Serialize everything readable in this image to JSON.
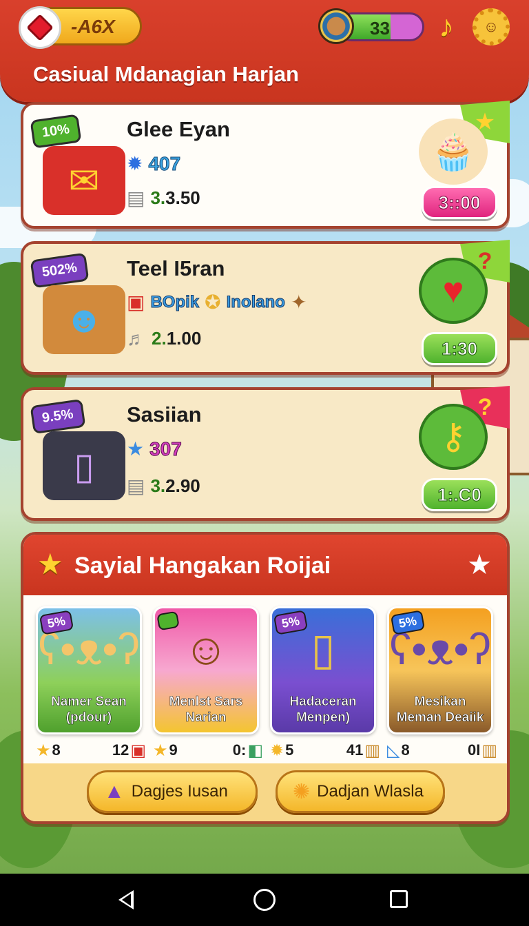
{
  "header": {
    "gem_value": "-A6X",
    "level_value": "33",
    "level_progress": 0.62,
    "title": "Casiual Mdanagian Harjan",
    "icons": [
      "gem-icon",
      "level-badge-icon",
      "music-note-icon",
      "sun-settings-icon"
    ]
  },
  "quests": [
    {
      "badge": "10%",
      "title": "Glee Eyan",
      "stat": "407",
      "cost_main": "3.",
      "cost_rest": "3.50",
      "timer": "3::00",
      "icons": [
        "red-chest-icon",
        "blue-gem-icon",
        "paper-stack-icon",
        "cupcake-icon",
        "star-flag-icon"
      ]
    },
    {
      "badge": "502%",
      "title": "Teel I5ran",
      "tag1": "BOpik",
      "tag2": "Inolano",
      "cost_main": "2.",
      "cost_rest": "1.00",
      "timer": "1:30",
      "icons": [
        "treasure-box-icon",
        "gift-icon",
        "star-coin-icon",
        "gingerbread-icon",
        "music-note-icon",
        "heart-icon",
        "question-flag-icon"
      ]
    },
    {
      "badge": "9.5%",
      "title": "Sasiian",
      "stat": "307",
      "cost_main": "3.",
      "cost_rest": "2.90",
      "timer": "1:.C0",
      "icons": [
        "smartphone-icon",
        "blue-star-icon",
        "paper-stack-icon",
        "key-icon",
        "exclamation-flag-icon"
      ]
    }
  ],
  "panel": {
    "title": "Sayial Hangakan Roijai",
    "items": [
      {
        "badge": "5%",
        "name_line1": "Namer Sean",
        "name_line2": "(pdour)",
        "left_stat": "8",
        "right_stat": "12",
        "left_icon": "star-icon",
        "right_icon": "gift-icon",
        "art_icon": "bear-icon"
      },
      {
        "badge": "",
        "name_line1": "Menlst Sars",
        "name_line2": "Narian",
        "left_stat": "9",
        "right_stat": "0:",
        "left_icon": "star-icon",
        "right_icon": "cube-icon",
        "art_icon": "boy-icon"
      },
      {
        "badge": "5%",
        "name_line1": "Hadaceran",
        "name_line2": "Menpen)",
        "left_stat": "5",
        "right_stat": "41",
        "left_icon": "gold-gear-icon",
        "right_icon": "ruler-icon",
        "art_icon": "phone-icon"
      },
      {
        "badge": "5%",
        "name_line1": "Mesikan",
        "name_line2": "Meman Deaiik",
        "left_stat": "8",
        "right_stat": "0I",
        "left_icon": "triangle-ruler-icon",
        "right_icon": "ruler-icon",
        "art_icon": "purple-bear-icon"
      }
    ],
    "buttons": [
      {
        "label": "Dagjes Iusan",
        "icon": "compass-arrow-icon"
      },
      {
        "label": "Dadjan Wlasla",
        "icon": "sun-icon"
      }
    ]
  },
  "navbar": {
    "icons": [
      "back-icon",
      "home-icon",
      "recents-icon"
    ]
  }
}
